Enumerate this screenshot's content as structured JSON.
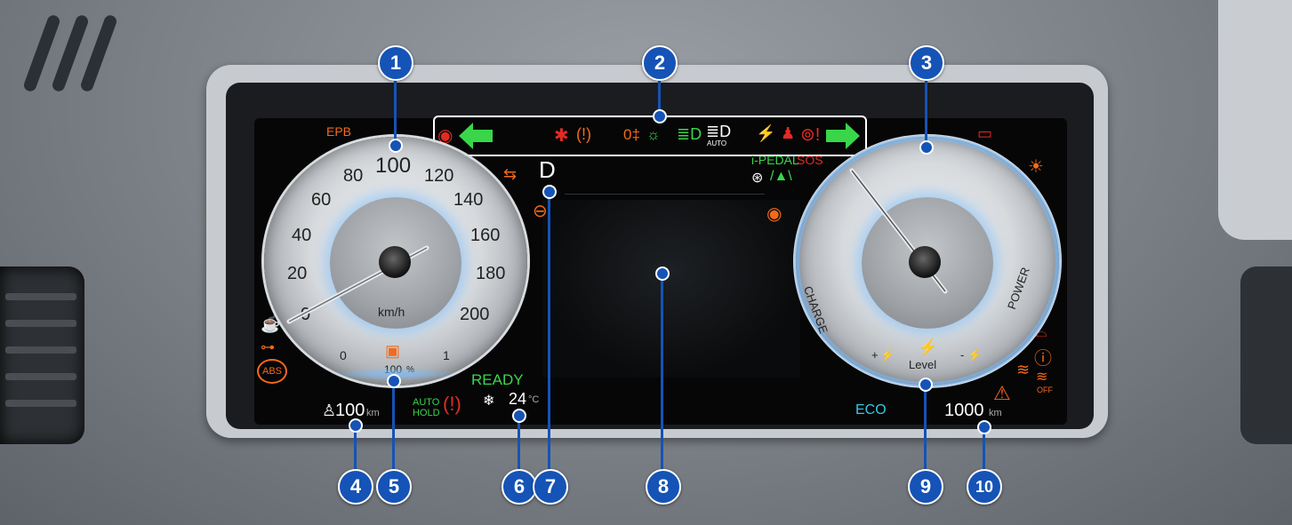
{
  "speedometer": {
    "ticks": [
      "0",
      "20",
      "40",
      "60",
      "80",
      "100",
      "120",
      "140",
      "160",
      "180",
      "200"
    ],
    "unit": "km/h",
    "epb_label": "EPB",
    "battery_gauge_min": "0",
    "battery_gauge_max": "1",
    "battery_percent": "100",
    "battery_percent_unit": "%",
    "speed_value": 12
  },
  "power_meter": {
    "charge_label": "CHARGE",
    "power_label": "POWER",
    "level_label": "Level",
    "plus_label": "+",
    "minus_label": "-"
  },
  "indicators": {
    "ipedal": "i-PEDAL",
    "sos": "SOS",
    "auto": "AUTO",
    "auto_hold_line1": "AUTO",
    "auto_hold_line2": "HOLD",
    "abs": "ABS",
    "off": "OFF",
    "ready": "READY",
    "eco": "ECO"
  },
  "status": {
    "gear": "D",
    "range_value": "100",
    "range_unit": "km",
    "temperature": "24",
    "temperature_unit": "°C",
    "odometer_value": "1000",
    "odometer_unit": "km"
  },
  "callouts": [
    "1",
    "2",
    "3",
    "4",
    "5",
    "6",
    "7",
    "8",
    "9",
    "10"
  ],
  "colors": {
    "callout": "#1553b6",
    "warning_orange": "#f26a1b",
    "indicator_green": "#3ad64a",
    "warning_red": "#e12b25",
    "glow_blue": "#78beff"
  }
}
